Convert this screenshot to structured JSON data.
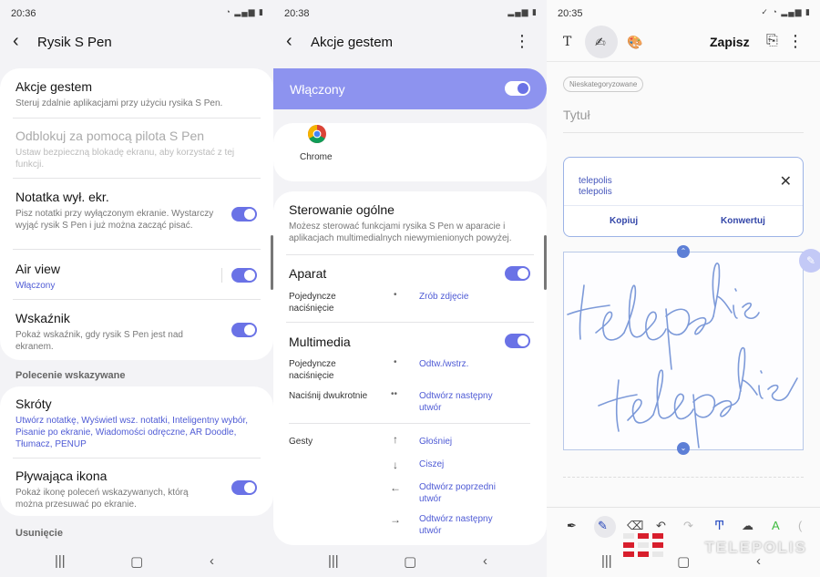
{
  "screen1": {
    "status_time": "20:36",
    "title": "Rysik S Pen",
    "items": [
      {
        "label": "Akcje gestem",
        "desc": "Steruj zdalnie aplikacjami przy użyciu rysika S Pen."
      },
      {
        "label": "Odblokuj za pomocą pilota S Pen",
        "desc": "Ustaw bezpieczną blokadę ekranu, aby korzystać z tej funkcji."
      },
      {
        "label": "Notatka wył. ekr.",
        "desc": "Pisz notatki przy wyłączonym ekranie. Wystarczy wyjąć rysik S Pen i już można zacząć pisać."
      },
      {
        "label": "Air view",
        "desc": "Włączony"
      },
      {
        "label": "Wskaźnik",
        "desc": "Pokaż wskaźnik, gdy rysik S Pen jest nad ekranem."
      }
    ],
    "section_suggested": "Polecenie wskazywane",
    "items2": [
      {
        "label": "Skróty",
        "desc": "Utwórz notatkę, Wyświetl wsz. notatki, Inteligentny wybór, Pisanie po ekranie, Wiadomości odręczne, AR Doodle, Tłumacz, PENUP"
      },
      {
        "label": "Pływająca ikona",
        "desc": "Pokaż ikonę poleceń wskazywanych, którą można przesuwać po ekranie."
      }
    ],
    "section_removal": "Usunięcie"
  },
  "screen2": {
    "status_time": "20:38",
    "title": "Akcje gestem",
    "enabled_label": "Włączony",
    "app_label": "Chrome",
    "general_title": "Sterowanie ogólne",
    "general_desc": "Możesz sterować funkcjami rysika S Pen w aparacie i aplikacjach multimedialnych niewymienionych powyżej.",
    "camera_title": "Aparat",
    "camera_single_label": "Pojedyncze naciśnięcie",
    "camera_single_action": "Zrób zdjęcie",
    "media_title": "Multimedia",
    "media_single_label": "Pojedyncze naciśnięcie",
    "media_single_action": "Odtw./wstrz.",
    "media_double_label": "Naciśnij dwukrotnie",
    "media_double_action": "Odtwórz następny utwór",
    "gestures_label": "Gesty",
    "gesture_up": "Głośniej",
    "gesture_down": "Ciszej",
    "gesture_left": "Odtwórz poprzedni utwór",
    "gesture_right": "Odtwórz następny utwór"
  },
  "screen3": {
    "status_time": "20:35",
    "save_label": "Zapisz",
    "category_tag": "Nieskategoryzowane",
    "title_placeholder": "Tytuł",
    "converted_line1": "telepolis",
    "converted_line2": "telepolis",
    "copy_label": "Kopiuj",
    "convert_label": "Konwertuj"
  },
  "watermark": "TELEPOLIS",
  "colors": {
    "accent": "#6a72e6",
    "link": "#4f5bd5",
    "enabled_bar": "#8d93ef",
    "ink": "#6f8fd8"
  }
}
